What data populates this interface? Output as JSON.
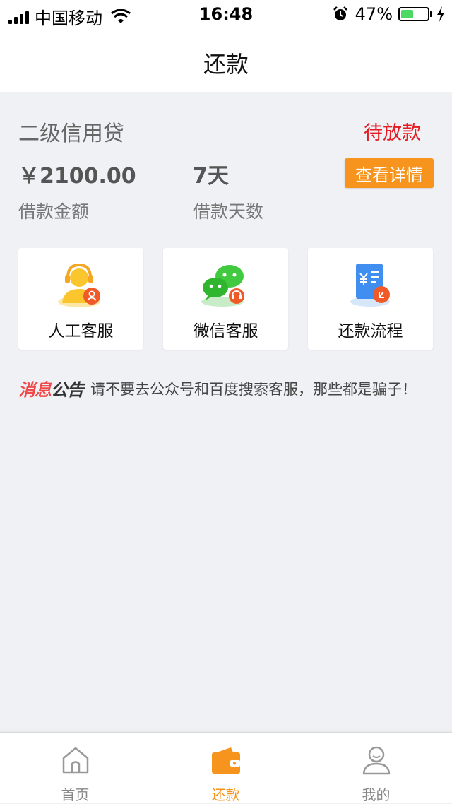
{
  "status_bar": {
    "carrier": "中国移动",
    "time": "16:48",
    "battery_percent": "47%",
    "battery_level": 0.47
  },
  "nav": {
    "title": "还款"
  },
  "loan": {
    "name": "二级信用贷",
    "status": "待放款",
    "amount": "￥2100.00",
    "amount_label": "借款金额",
    "days": "7天",
    "days_label": "借款天数",
    "detail_button": "查看详情"
  },
  "services": [
    {
      "label": "人工客服",
      "icon": "customer-service-agent-icon"
    },
    {
      "label": "微信客服",
      "icon": "wechat-icon"
    },
    {
      "label": "还款流程",
      "icon": "repayment-process-icon"
    }
  ],
  "notice": {
    "tag_part1": "消息",
    "tag_part2": "公告",
    "text": "请不要去公众号和百度搜索客服，那些都是骗子！"
  },
  "tabs": [
    {
      "label": "首页",
      "icon": "home-icon",
      "active": false
    },
    {
      "label": "还款",
      "icon": "wallet-icon",
      "active": true
    },
    {
      "label": "我的",
      "icon": "user-profile-icon",
      "active": false
    }
  ],
  "colors": {
    "accent": "#f7941d",
    "status_red": "#e51c23",
    "background": "#f0f1f5",
    "battery_green": "#4cd964",
    "wechat_green": "#41c940"
  }
}
